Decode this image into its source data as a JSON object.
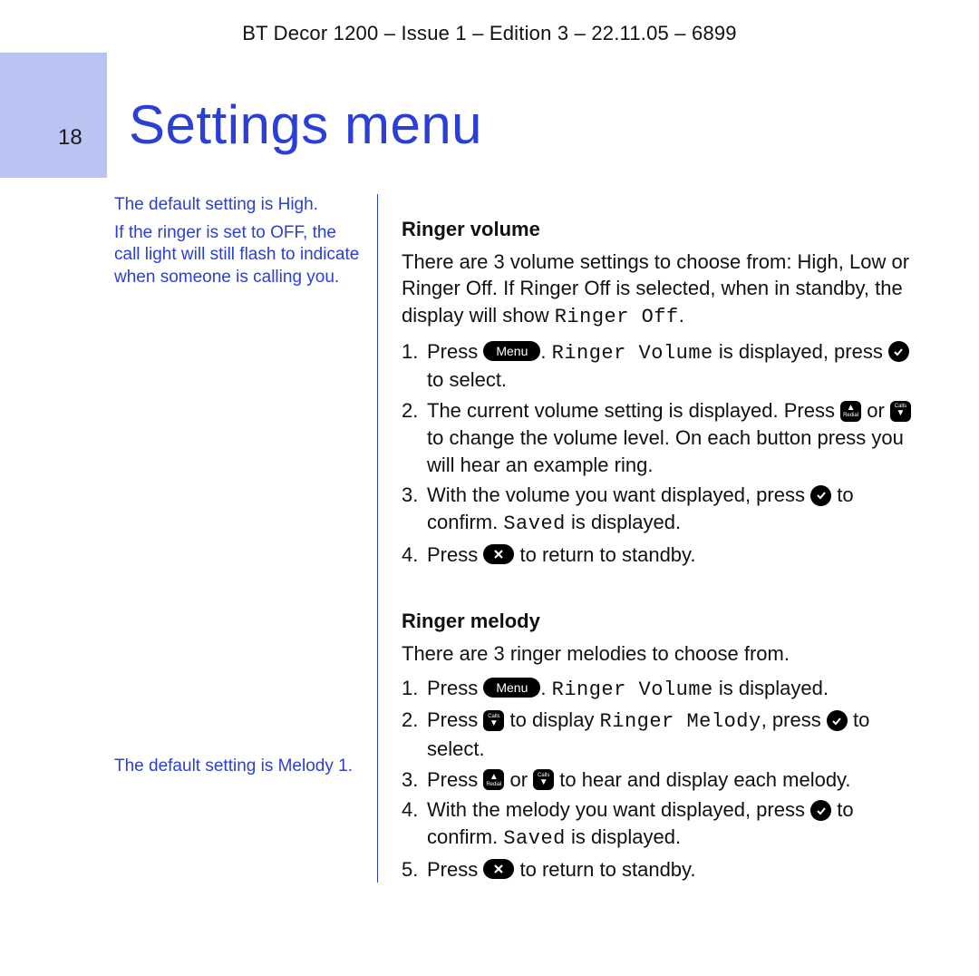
{
  "doc_header": "BT Decor 1200 – Issue 1 – Edition 3 – 22.11.05 – 6899",
  "page_number": "18",
  "page_title": "Settings menu",
  "side": {
    "volume_note_1": "The default setting is High.",
    "volume_note_2": "If the ringer is set to OFF, the call light will still flash to indicate when someone is calling you.",
    "melody_note": "The default setting is Melody 1."
  },
  "icons": {
    "menu_label": "Menu",
    "calls_label": "Calls",
    "redial_label": "Redial"
  },
  "ringer_volume": {
    "heading": "Ringer volume",
    "intro_a": "There are 3 volume settings to choose from: High, Low or Ringer Off. If Ringer Off is selected, when in standby, the display will show ",
    "intro_lcd": "Ringer Off",
    "intro_b": ".",
    "s1_a": "Press ",
    "s1_b": ". ",
    "s1_lcd": "Ringer Volume",
    "s1_c": " is displayed, press ",
    "s1_d": " to select.",
    "s2_a": "The current volume setting is displayed. Press ",
    "s2_b": " or ",
    "s2_c": " to change the volume level. On each button press you will hear an example ring.",
    "s3_a": "With the volume you want displayed, press ",
    "s3_b": " to confirm. ",
    "s3_lcd": "Saved",
    "s3_c": " is displayed.",
    "s4_a": "Press ",
    "s4_b": " to return to standby."
  },
  "ringer_melody": {
    "heading": "Ringer melody",
    "intro": "There are 3 ringer melodies to choose from.",
    "s1_a": "Press ",
    "s1_b": ". ",
    "s1_lcd": "Ringer Volume",
    "s1_c": " is displayed.",
    "s2_a": "Press ",
    "s2_b": " to display ",
    "s2_lcd": "Ringer Melody",
    "s2_c": ", press ",
    "s2_d": " to select.",
    "s3_a": "Press ",
    "s3_b": " or ",
    "s3_c": " to hear and display each melody.",
    "s4_a": "With the melody you want displayed, press ",
    "s4_b": " to confirm. ",
    "s4_lcd": "Saved",
    "s4_c": " is displayed.",
    "s5_a": "Press ",
    "s5_b": " to return to standby."
  },
  "nums": {
    "n1": "1.",
    "n2": "2.",
    "n3": "3.",
    "n4": "4.",
    "n5": "5."
  }
}
